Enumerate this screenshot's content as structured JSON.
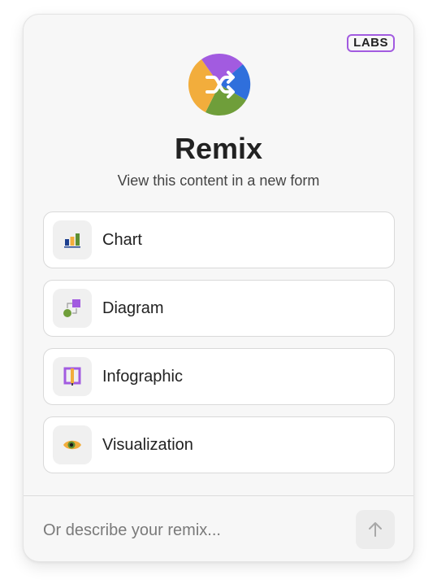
{
  "badge": {
    "label": "LABS"
  },
  "header": {
    "title": "Remix",
    "subtitle": "View this content in a new form",
    "logo_icon": "shuffle-icon",
    "logo_colors": [
      "#a25be0",
      "#2f6fdc",
      "#6f9e3a",
      "#f2ad3c"
    ]
  },
  "options": [
    {
      "label": "Chart",
      "icon": "bar-chart-icon"
    },
    {
      "label": "Diagram",
      "icon": "diagram-icon"
    },
    {
      "label": "Infographic",
      "icon": "infographic-icon"
    },
    {
      "label": "Visualization",
      "icon": "eye-icon"
    }
  ],
  "prompt": {
    "placeholder": "Or describe your remix...",
    "value": "",
    "send_icon": "arrow-up-icon"
  }
}
